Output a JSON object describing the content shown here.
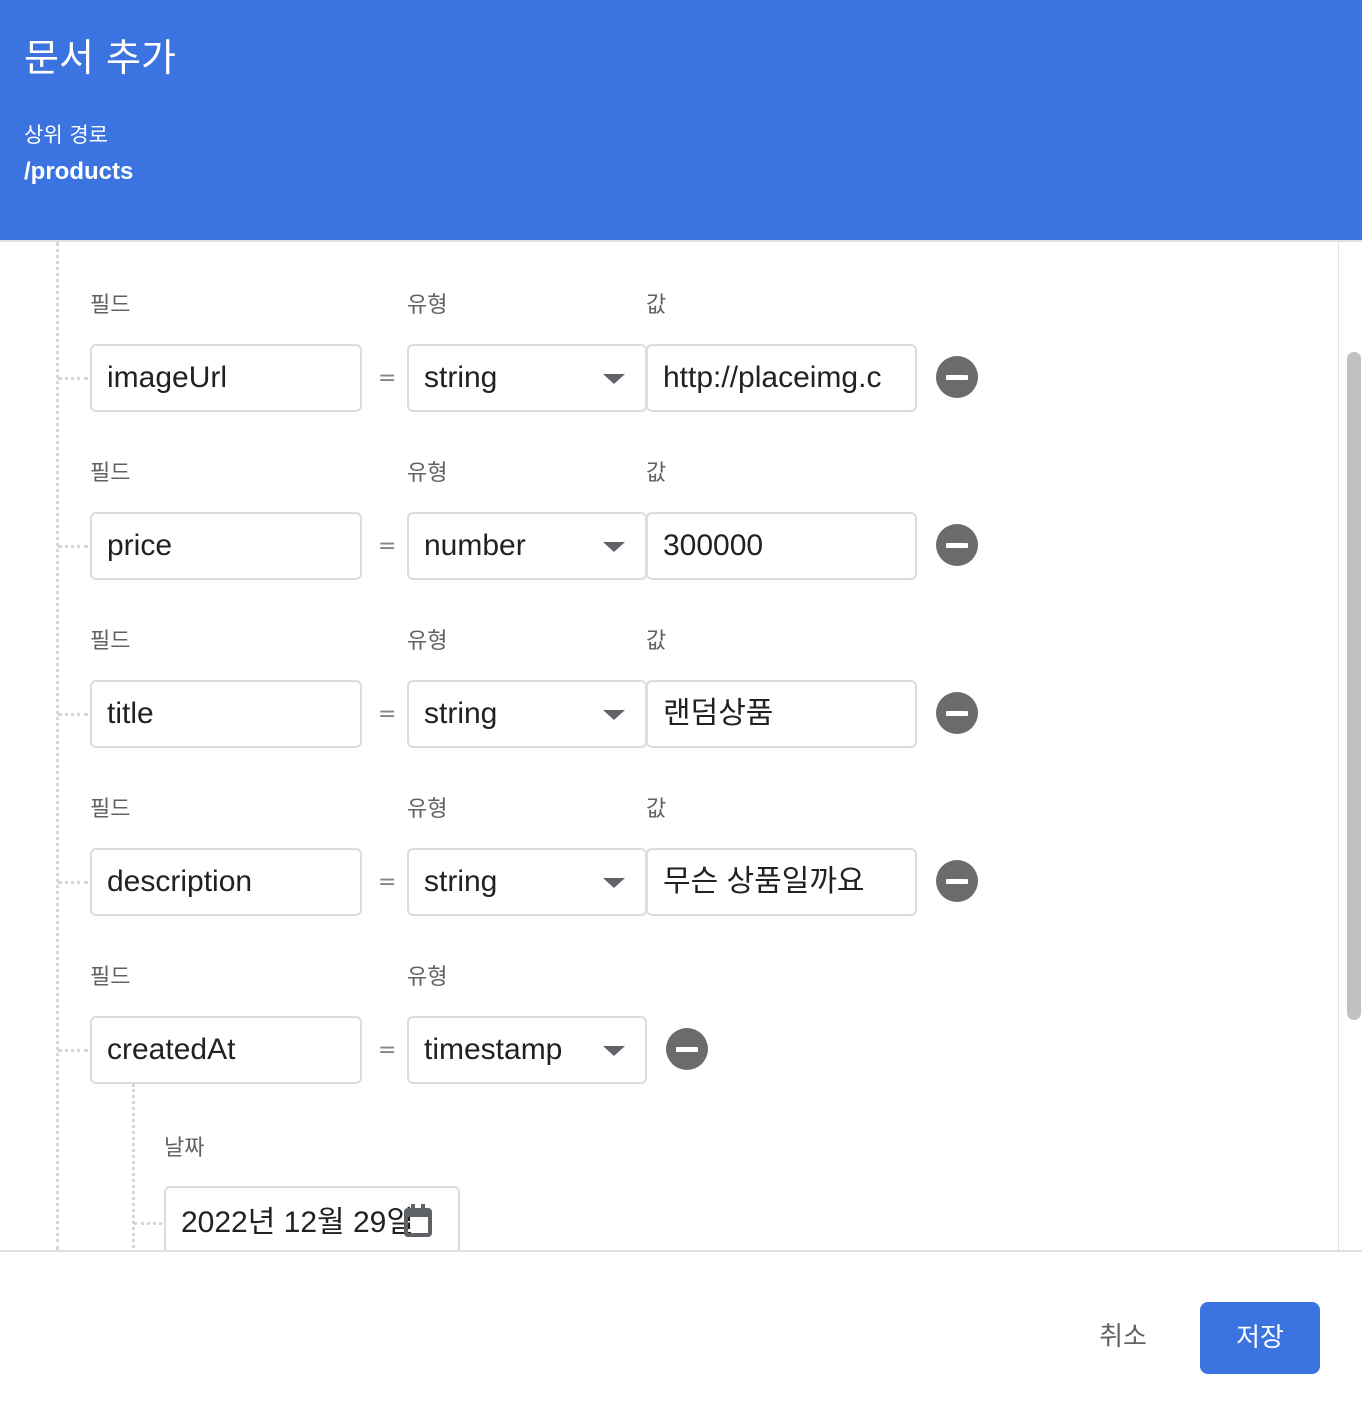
{
  "dialog": {
    "title": "문서 추가",
    "parent_path_label": "상위 경로",
    "parent_path_value": "/products"
  },
  "labels": {
    "field": "필드",
    "type": "유형",
    "value": "값",
    "equals": "=",
    "date": "날짜"
  },
  "fields": [
    {
      "name": "imageUrl",
      "type": "string",
      "value": "http://placeimg.c"
    },
    {
      "name": "price",
      "type": "number",
      "value": "300000"
    },
    {
      "name": "title",
      "type": "string",
      "value": "랜덤상품"
    },
    {
      "name": "description",
      "type": "string",
      "value": "무슨 상품일까요"
    },
    {
      "name": "createdAt",
      "type": "timestamp",
      "date": "2022년 12월 29일"
    }
  ],
  "footer": {
    "cancel_label": "취소",
    "save_label": "저장"
  },
  "colors": {
    "header_bg": "#3b73e0",
    "primary_button": "#3b73e0",
    "remove_icon": "#6b6b6b"
  },
  "icons": [
    "remove-field-icon",
    "dropdown-arrow-icon",
    "calendar-icon"
  ]
}
